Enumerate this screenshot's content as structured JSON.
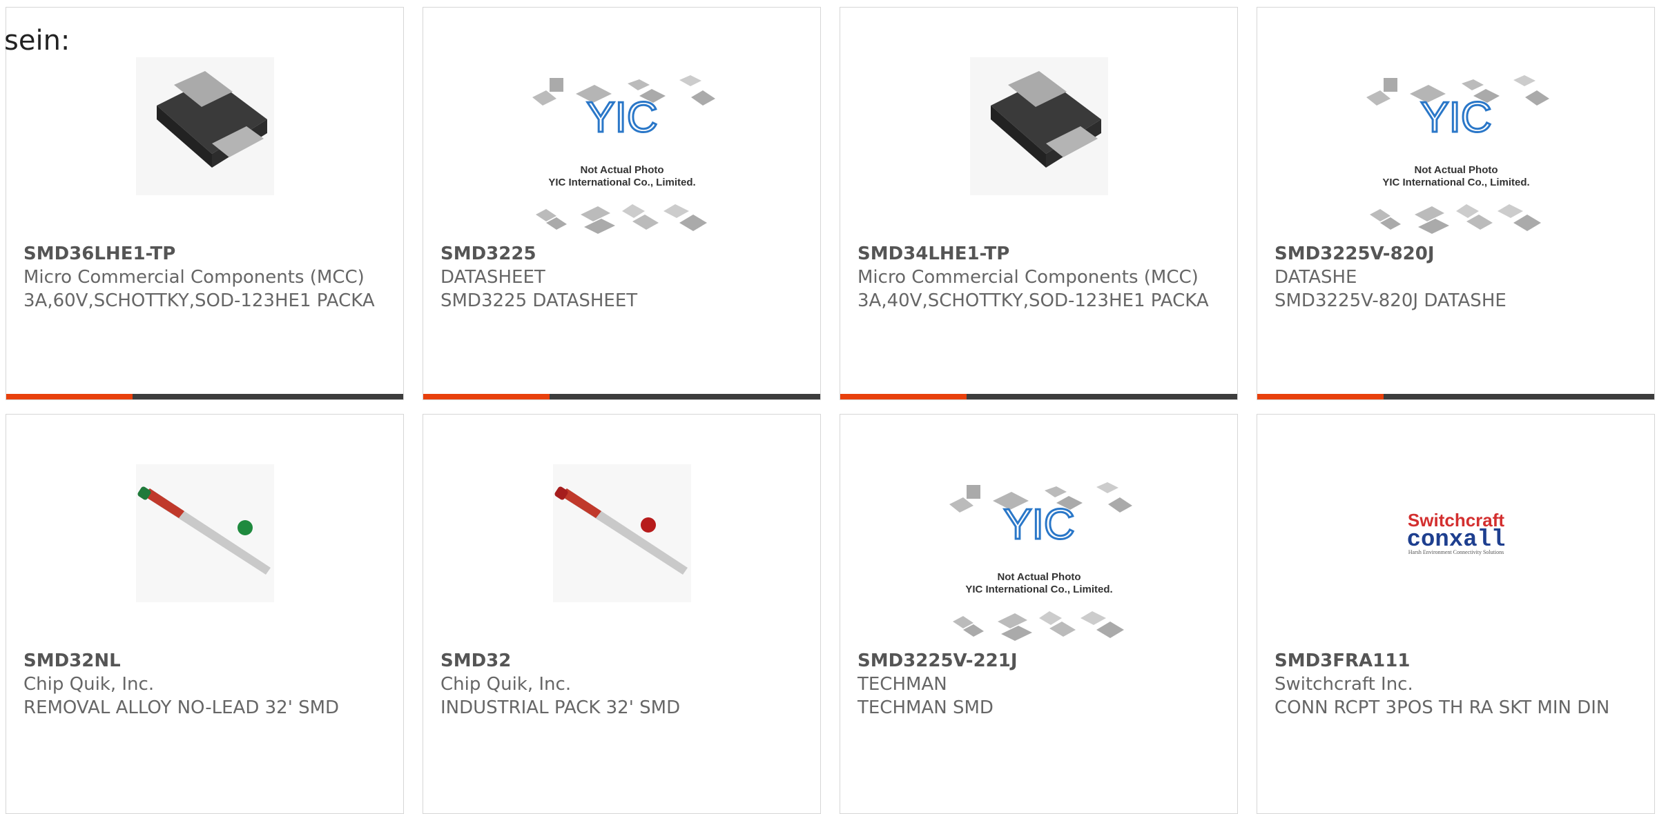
{
  "lead_text": "sein:",
  "colors": {
    "accent": "#e8400c",
    "bar": "#3d3d3d",
    "border": "#d6d6d6"
  },
  "cards": [
    {
      "part": "SMD36LHE1-TP",
      "maker": "Micro Commercial Components (MCC)",
      "desc": "3A,60V,SCHOTTKY,SOD-123HE1 PACKA",
      "image": "diode-sod123-photo"
    },
    {
      "part": "SMD3225",
      "maker": "DATASHEET",
      "desc": "SMD3225 DATASHEET",
      "image": "yic-not-actual-photo",
      "ph1": "Not Actual Photo",
      "ph2": "YIC International Co., Limited."
    },
    {
      "part": "SMD34LHE1-TP",
      "maker": "Micro Commercial Components (MCC)",
      "desc": "3A,40V,SCHOTTKY,SOD-123HE1 PACKA",
      "image": "diode-sod123-photo"
    },
    {
      "part": "SMD3225V-820J",
      "maker": "DATASHE",
      "desc": "SMD3225V-820J DATASHE",
      "image": "yic-not-actual-photo",
      "ph1": "Not Actual Photo",
      "ph2": "YIC International Co., Limited."
    },
    {
      "part": "SMD32NL",
      "maker": "Chip Quik, Inc.",
      "desc": "REMOVAL ALLOY NO-LEAD 32' SMD",
      "image": "solder-tube-green-cap"
    },
    {
      "part": "SMD32",
      "maker": "Chip Quik, Inc.",
      "desc": "INDUSTRIAL PACK 32' SMD",
      "image": "solder-tube-red-cap"
    },
    {
      "part": "SMD3225V-221J",
      "maker": "TECHMAN",
      "desc": "TECHMAN SMD",
      "image": "yic-not-actual-photo",
      "ph1": "Not Actual Photo",
      "ph2": "YIC International Co., Limited."
    },
    {
      "part": "SMD3FRA111",
      "maker": "Switchcraft Inc.",
      "desc": "CONN RCPT 3POS TH RA SKT MIN DIN",
      "image": "switchcraft-conxall-logo",
      "logo1": "Switchcraft",
      "logo2": "conxall",
      "logo3": "Harsh Environment Connectivity Solutions"
    }
  ]
}
